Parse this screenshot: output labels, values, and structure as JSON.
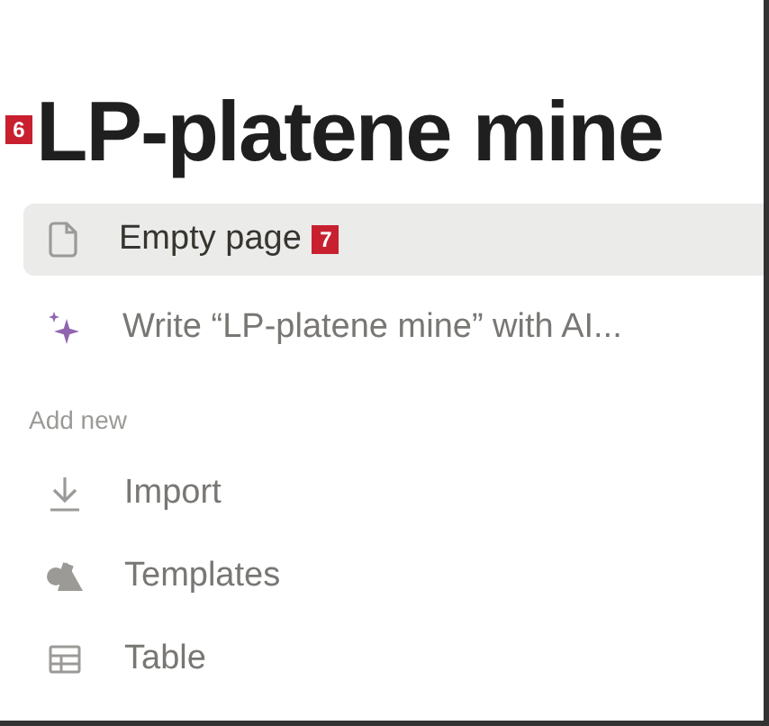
{
  "title": {
    "text": "LP-platene mine",
    "badge": "6"
  },
  "options": [
    {
      "kind": "page",
      "label": "Empty page",
      "badge": "7",
      "selected": true
    },
    {
      "kind": "ai",
      "label": "Write “LP-platene mine” with AI...",
      "selected": false
    }
  ],
  "add_new": {
    "heading": "Add new",
    "items": [
      {
        "kind": "import",
        "label": "Import"
      },
      {
        "kind": "templates",
        "label": "Templates"
      },
      {
        "kind": "table",
        "label": "Table"
      }
    ]
  }
}
